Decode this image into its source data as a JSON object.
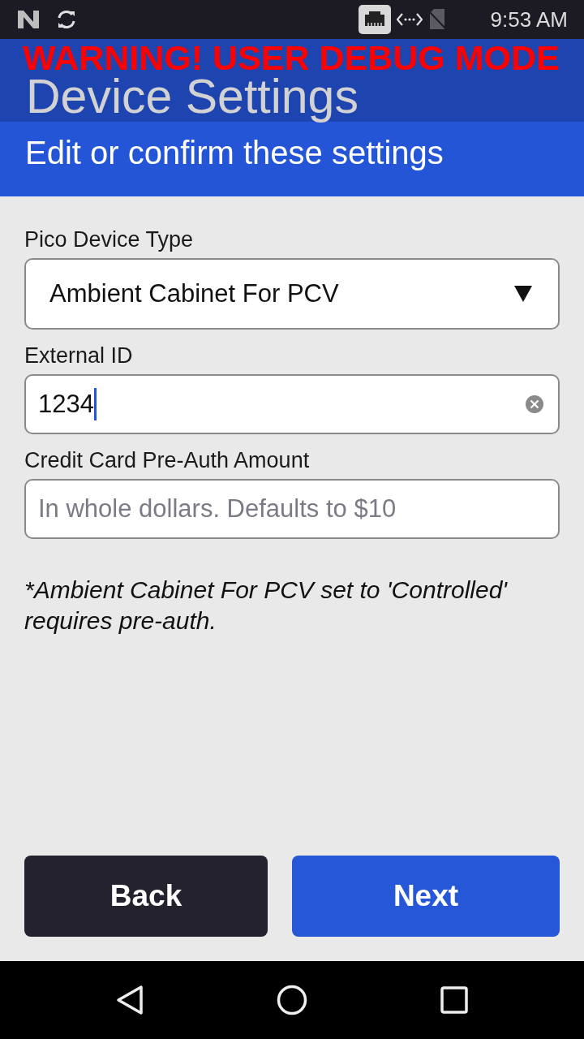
{
  "status_bar": {
    "time": "9:53 AM"
  },
  "header": {
    "warning": "WARNING! USER DEBUG MODE",
    "title": "Device Settings",
    "subtitle": "Edit or confirm these settings"
  },
  "fields": [
    {
      "kind": "dropdown",
      "label": "Pico Device Type",
      "value": "Ambient Cabinet For PCV"
    },
    {
      "kind": "text",
      "label": "External ID",
      "value": "1234",
      "focused": true
    },
    {
      "kind": "text",
      "label": "Credit Card Pre-Auth Amount",
      "placeholder": "In whole dollars. Defaults to $10",
      "focused": false
    }
  ],
  "note": "*Ambient Cabinet For PCV set to 'Controlled' requires pre-auth.",
  "buttons": [
    {
      "label": "Back",
      "kind": "secondary"
    },
    {
      "label": "Next",
      "kind": "primary"
    }
  ]
}
